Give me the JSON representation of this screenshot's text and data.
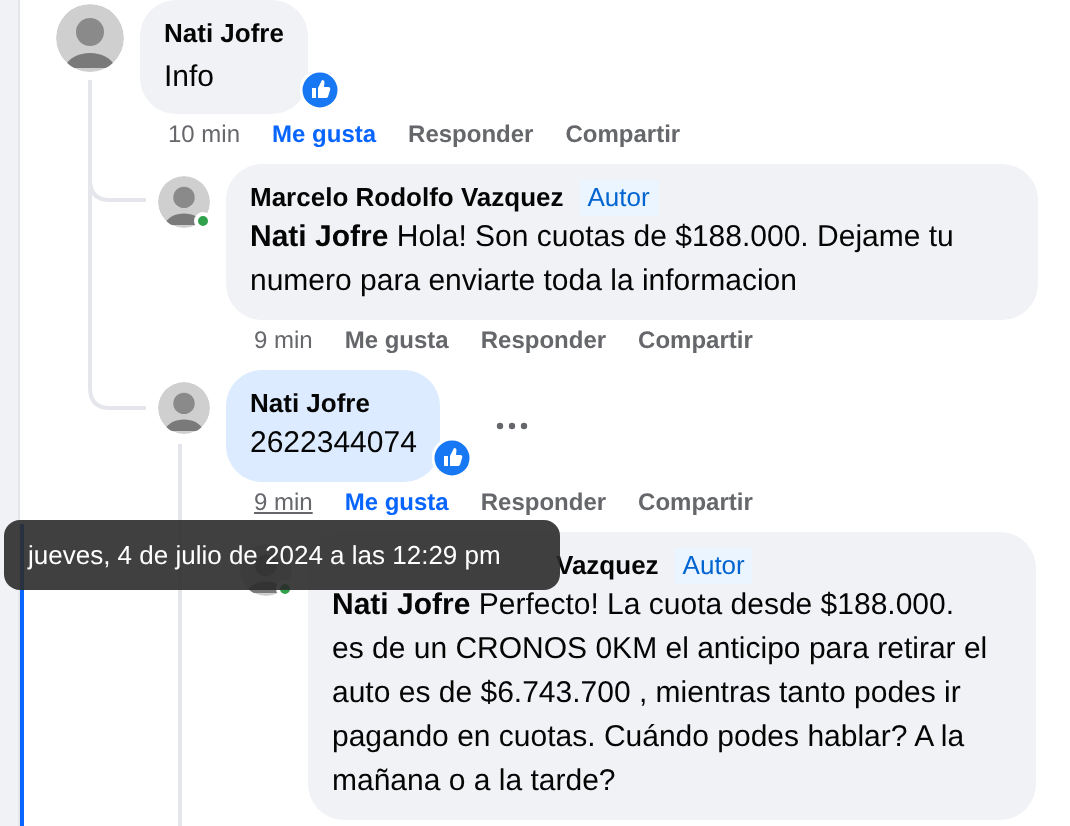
{
  "comments": [
    {
      "author": "Nati Jofre",
      "text": "Info",
      "time": "10 min",
      "time_hovered": false,
      "like_label": "Me gusta",
      "liked": true,
      "reply_label": "Responder",
      "share_label": "Compartir",
      "like_reaction": true,
      "children": [
        {
          "author": "Marcelo Rodolfo Vazquez",
          "badge": "Autor",
          "mention": "Nati Jofre",
          "text": "Hola! Son cuotas de $188.000. Dejame tu numero para enviarte toda la informacion",
          "time": "9 min",
          "time_hovered": false,
          "like_label": "Me gusta",
          "liked": false,
          "reply_label": "Responder",
          "share_label": "Compartir",
          "online": true
        },
        {
          "author": "Nati Jofre",
          "text": "2622344074",
          "time": "9 min",
          "time_hovered": true,
          "like_label": "Me gusta",
          "liked": true,
          "reply_label": "Responder",
          "share_label": "Compartir",
          "like_reaction": true,
          "highlighted": true,
          "more_button": true,
          "children": [
            {
              "author": "Vazquez",
              "author_covered": true,
              "badge": "Autor",
              "mention": "Nati Jofre",
              "text": "Perfecto! La cuota desde $188.000. es de un CRONOS 0KM el anticipo para retirar el auto es de $6.743.700 , mientras tanto podes ir pagando en cuotas. Cuándo podes hablar? A la mañana o a la tarde?",
              "online": true
            }
          ]
        }
      ]
    }
  ],
  "tooltip": "jueves, 4 de julio de 2024 a las 12:29 pm"
}
